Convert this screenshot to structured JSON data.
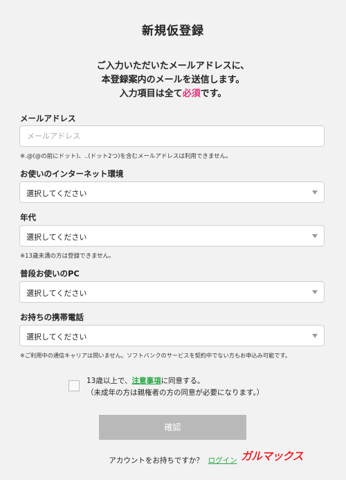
{
  "header": {
    "title": "新規仮登録"
  },
  "intro": {
    "line1": "ご入力いただいたメールアドレスに、",
    "line2": "本登録案内のメールを送信します。",
    "line3_pre": "入力項目は全て",
    "line3_req": "必須",
    "line3_post": "です。"
  },
  "form": {
    "email": {
      "label": "メールアドレス",
      "placeholder": "メールアドレス",
      "note": "※.@(@の前にドット)、..(ドット2つ)を含むメールアドレスは利用できません。"
    },
    "internet_env": {
      "label": "お使いのインターネット環境",
      "value": "選択してください"
    },
    "age": {
      "label": "年代",
      "value": "選択してください",
      "note": "※13歳未満の方は登録できません。"
    },
    "pc": {
      "label": "普段お使いのPC",
      "value": "選択してください"
    },
    "mobile": {
      "label": "お持ちの携帯電話",
      "value": "選択してください",
      "note": "※ご利用中の通信キャリアは問いません。ソフトバンクのサービスを契約中でない方もお申込み可能です。"
    }
  },
  "agreement": {
    "pre": "13歳以上で、",
    "link": "注意事項",
    "post": "に同意する。",
    "sub": "（未成年の方は親権者の方の同意が必要になります。）"
  },
  "confirm_button": "確認",
  "footer": {
    "question": "アカウントをお持ちですか？",
    "login_link": "ログイン"
  },
  "watermark": "ガルマックス",
  "colors": {
    "accent_required": "#e0307a",
    "link": "#28a745",
    "button_disabled": "#b9b9b9",
    "watermark": "#e8262a"
  },
  "icons": {
    "select_caret": "caret-down-icon",
    "checkbox": "checkbox-icon"
  }
}
